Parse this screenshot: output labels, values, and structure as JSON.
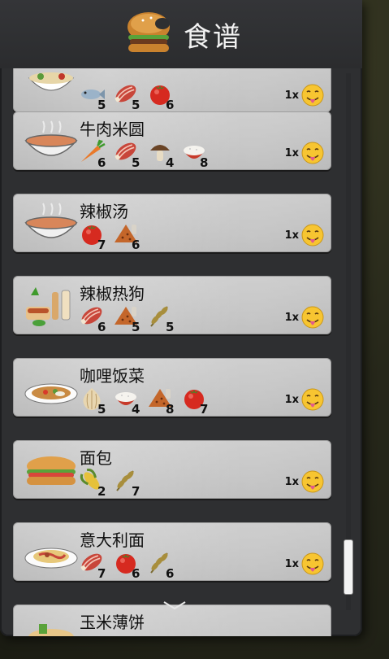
{
  "header": {
    "title": "食谱"
  },
  "recipes": [
    {
      "name": "",
      "dish": "rice-bowl",
      "ingredients": [
        {
          "icon": "fish-icon",
          "count": "5"
        },
        {
          "icon": "meat-icon",
          "count": "5"
        },
        {
          "icon": "tomato-icon",
          "count": "6"
        }
      ],
      "qty": "1x"
    },
    {
      "name": "牛肉米圆",
      "dish": "soup-bowl",
      "ingredients": [
        {
          "icon": "carrot-icon",
          "count": "6"
        },
        {
          "icon": "meat-icon",
          "count": "5"
        },
        {
          "icon": "mushroom-icon",
          "count": "4"
        },
        {
          "icon": "rice-icon",
          "count": "8"
        }
      ],
      "qty": "1x"
    },
    {
      "name": "辣椒汤",
      "dish": "soup-bowl",
      "ingredients": [
        {
          "icon": "tomato-icon",
          "count": "7"
        },
        {
          "icon": "spice-icon",
          "count": "6"
        }
      ],
      "qty": "1x"
    },
    {
      "name": "辣椒热狗",
      "dish": "hotdog",
      "ingredients": [
        {
          "icon": "meat-icon",
          "count": "6"
        },
        {
          "icon": "spice-icon",
          "count": "5"
        },
        {
          "icon": "wheat-icon",
          "count": "5"
        }
      ],
      "qty": "1x"
    },
    {
      "name": "咖哩饭菜",
      "dish": "curry-plate",
      "ingredients": [
        {
          "icon": "onion-icon",
          "count": "5"
        },
        {
          "icon": "rice-icon",
          "count": "4"
        },
        {
          "icon": "spice-icon",
          "count": "8"
        },
        {
          "icon": "tomato-icon",
          "count": "7"
        }
      ],
      "qty": "1x"
    },
    {
      "name": "面包",
      "dish": "sandwich",
      "ingredients": [
        {
          "icon": "corn-icon",
          "count": "2"
        },
        {
          "icon": "wheat-icon",
          "count": "7"
        }
      ],
      "qty": "1x"
    },
    {
      "name": "意大利面",
      "dish": "pasta-plate",
      "ingredients": [
        {
          "icon": "meat-icon",
          "count": "7"
        },
        {
          "icon": "tomato-icon",
          "count": "6"
        },
        {
          "icon": "wheat-icon",
          "count": "6"
        }
      ],
      "qty": "1x"
    },
    {
      "name": "玉米薄饼",
      "dish": "tortilla",
      "ingredients": [],
      "qty": ""
    }
  ]
}
